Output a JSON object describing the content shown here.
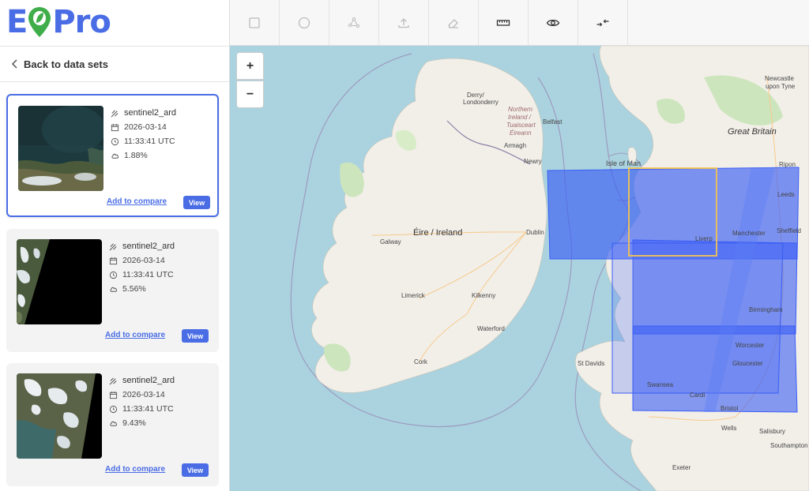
{
  "app": {
    "logo_left": "E",
    "logo_right": "Pro"
  },
  "sidebar": {
    "back_label": "Back to data sets"
  },
  "results": [
    {
      "collection": "sentinel2_ard",
      "date": "2026-03-14",
      "time": "11:33:41 UTC",
      "cloud": "1.88%",
      "compare_label": "Add to compare",
      "view_label": "View"
    },
    {
      "collection": "sentinel2_ard",
      "date": "2026-03-14",
      "time": "11:33:41 UTC",
      "cloud": "5.56%",
      "compare_label": "Add to compare",
      "view_label": "View"
    },
    {
      "collection": "sentinel2_ard",
      "date": "2026-03-14",
      "time": "11:33:41 UTC",
      "cloud": "9.43%",
      "compare_label": "Add to compare",
      "view_label": "View"
    }
  ],
  "toolbar": {
    "tools": [
      "square-icon",
      "circle-icon",
      "polygon-icon",
      "upload-icon",
      "eraser-icon",
      "ruler-icon",
      "eye-icon",
      "collapse-arrows-icon"
    ]
  },
  "map": {
    "zoom_in": "+",
    "zoom_out": "−",
    "labels": {
      "derry": "Derry/",
      "londonderry": "Londonderry",
      "northern": "Northern",
      "ireland_ni": "Ireland /",
      "tuaisceart": "Tuaisceart",
      "eireann": "Éireann",
      "belfast": "Belfast",
      "armagh": "Armagh",
      "newry": "Newry",
      "isle_of_man": "Isle of Man",
      "eire": "Éire / Ireland",
      "galway": "Galway",
      "dublin": "Dublin",
      "limerick": "Limerick",
      "kilkenny": "Kilkenny",
      "waterford": "Waterford",
      "cork": "Cork",
      "newcastle": "Newcastle",
      "upon_tyne": "upon Tyne",
      "great_britain": "Great Britain",
      "ripon": "Ripon",
      "leeds": "Leeds",
      "manchester": "Manchester",
      "sheffield": "Sheffield",
      "liverpool": "Liverp",
      "birmingham": "Birmingham",
      "st_davids": "St Davids",
      "worcester": "Worcester",
      "gloucester": "Gloucester",
      "swansea": "Swansea",
      "cardiff": "Cardi",
      "bristol": "Bristol",
      "wells": "Wells",
      "salisbury": "Salisbury",
      "southampton": "Southampton",
      "exeter": "Exeter"
    }
  }
}
